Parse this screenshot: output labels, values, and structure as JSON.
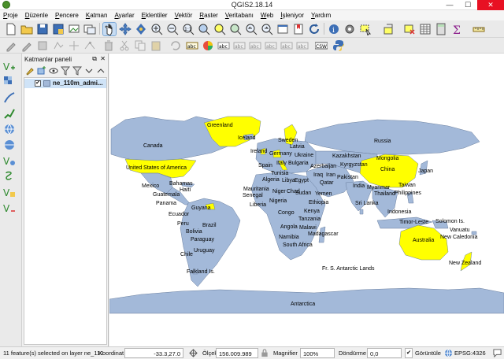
{
  "window": {
    "title": "QGIS2.18.14",
    "minimize": "—",
    "maximize": "☐",
    "close": "✕"
  },
  "menu": [
    "Proje",
    "Düzenle",
    "Pencere",
    "Katman",
    "Ayarlar",
    "Eklentiler",
    "Vektör",
    "Raster",
    "Veritabanı",
    "Web",
    "İşleniyor",
    "Yardım"
  ],
  "layers_panel": {
    "title": "Katmanlar paneli",
    "float": "⧉",
    "close": "✕",
    "layer": {
      "name": "ne_110m_admi...",
      "checked": "✔"
    }
  },
  "map": {
    "land_color": "#a3b9d9",
    "selected_color": "#ffff00",
    "background": "#ffffff",
    "labels": {
      "greenland": "Greenland",
      "iceland": "Iceland",
      "canada": "Canada",
      "usa": "United States of America",
      "mexico": "Mexico",
      "bahamas": "Bahamas",
      "haiti": "Haiti",
      "guatemala": "Guatemala",
      "panama": "Panama",
      "guyana": "Guyana",
      "ecuador": "Ecuador",
      "peru": "Peru",
      "brazil": "Brazil",
      "bolivia": "Bolivia",
      "paraguay": "Paraguay",
      "uruguay": "Uruguay",
      "chile": "Chile",
      "falkland": "Falkland Is.",
      "sweden": "Sweden",
      "ireland": "Ireland",
      "germany": "Germany",
      "latvia": "Latvia",
      "ukraine": "Ukraine",
      "spain": "Spain",
      "italy": "Italy",
      "bulgaria": "Bulgaria",
      "russia": "Russia",
      "kazakhstan": "Kazakhstan",
      "mongolia": "Mongolia",
      "azerbaijan": "Azerbaijan",
      "kyrgyzstan": "Kyrgyzstan",
      "china": "China",
      "japan": "Japan",
      "tunisia": "Tunisia",
      "algeria": "Algeria",
      "libya": "Libya",
      "egypt": "Egypt",
      "iraq": "Iraq",
      "iran": "Iran",
      "qatar": "Qatar",
      "pakistan": "Pakistan",
      "india": "India",
      "myanmar": "Myanmar",
      "taiwan": "Taiwan",
      "thailand": "Thailand",
      "philippines": "Philippines",
      "mauritania": "Mauritania",
      "senegal": "Senegal",
      "niger": "Niger",
      "chad": "Chad",
      "sudan": "Sudan",
      "yemen": "Yemen",
      "liberia": "Liberia",
      "nigeria": "Nigeria",
      "ethiopia": "Ethiopia",
      "congo": "Congo",
      "kenya": "Kenya",
      "tanzania": "Tanzania",
      "angola": "Angola",
      "malawi": "Malawi",
      "namibia": "Namibia",
      "madagascar": "Madagascar",
      "south_africa": "South Africa",
      "sri_lanka": "Sri Lanka",
      "indonesia": "Indonesia",
      "timor_leste": "Timor-Leste",
      "solomon": "Solomon Is.",
      "vanuatu": "Vanuatu",
      "new_caledonia": "New Caledonia",
      "australia": "Australia",
      "new_zealand": "New Zealand",
      "fr_antarctic": "Fr. S. Antarctic Lands",
      "antarctica": "Antarctica"
    }
  },
  "status": {
    "selection": "11 feature(s) selected on layer ne_110",
    "coord_label": "Koordinat",
    "coord_value": "-33.3,27.0",
    "scale_label": "Ölçek",
    "scale_value": "156.009.989",
    "magnifier_label": "Magnifier",
    "magnifier_value": "100%",
    "rotation_label": "Döndürme",
    "rotation_value": "0,0",
    "render_label": "Görüntüle",
    "render_checked": "✔",
    "crs": "EPSG:4326"
  }
}
